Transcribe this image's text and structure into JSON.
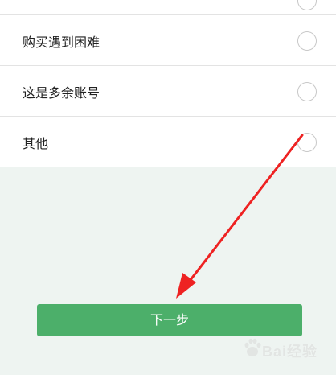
{
  "options": [
    {
      "label": ""
    },
    {
      "label": "购买遇到困难"
    },
    {
      "label": "这是多余账号"
    },
    {
      "label": "其他"
    }
  ],
  "next_button": {
    "label": "下一步"
  },
  "watermark": {
    "text": "Bai经验"
  },
  "colors": {
    "primary_green": "#4caf6a",
    "annotation_arrow": "#ee2222",
    "footer_background": "#eef4f1"
  },
  "icons": {
    "radio": "radio-unchecked-icon",
    "annotation": "red-arrow-icon",
    "watermark_logo": "baidu-paw-icon"
  }
}
